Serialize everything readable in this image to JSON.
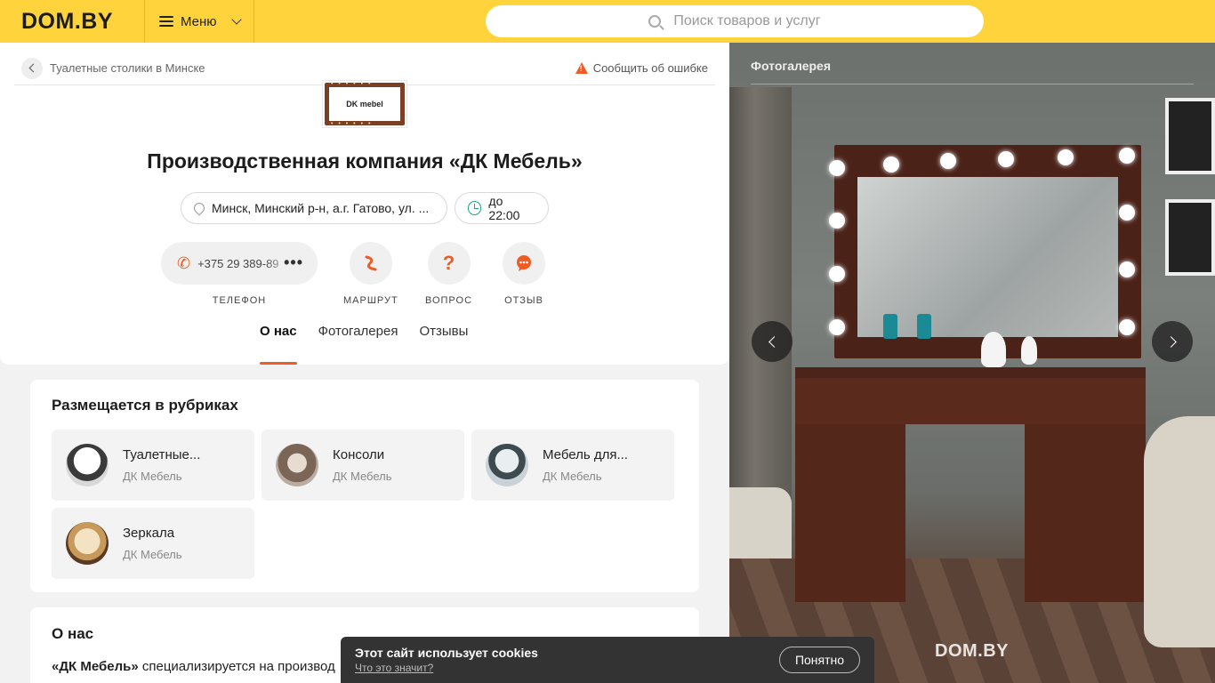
{
  "header": {
    "logo": "DOM.BY",
    "menu_label": "Меню",
    "search_placeholder": "Поиск товаров и услуг"
  },
  "breadcrumb": {
    "label": "Туалетные столики в Минске"
  },
  "report_label": "Сообщить об ошибке",
  "company": {
    "logo_text": "DK mebel",
    "title": "Производственная компания «ДК Мебель»",
    "address": "Минск, Минский р-н, а.г. Гатово, ул. ...",
    "hours": "до 22:00"
  },
  "actions": {
    "phone_number": "+375 29 389-89",
    "phone_more": "•••",
    "phone_label": "ТЕЛЕФОН",
    "route_label": "МАРШРУТ",
    "question_label": "ВОПРОС",
    "review_label": "ОТЗЫВ"
  },
  "tabs": [
    {
      "label": "О нас"
    },
    {
      "label": "Фотогалерея"
    },
    {
      "label": "Отзывы"
    }
  ],
  "rubrics": {
    "title": "Размещается в рубриках",
    "items": [
      {
        "name": "Туалетные...",
        "company": "ДК Мебель"
      },
      {
        "name": "Консоли",
        "company": "ДК Мебель"
      },
      {
        "name": "Мебель для...",
        "company": "ДК Мебель"
      },
      {
        "name": "Зеркала",
        "company": "ДК Мебель"
      }
    ]
  },
  "about": {
    "title": "О нас",
    "text_bold": "«ДК Мебель»",
    "text": " специализируется на производ"
  },
  "gallery": {
    "title": "Фотогалерея",
    "watermark": "DOM.BY"
  },
  "cookie": {
    "title": "Этот сайт использует cookies",
    "link": "Что это значит?",
    "button": "Понятно"
  },
  "colors": {
    "brand_yellow": "#fed33c",
    "accent_orange": "#ef5b24",
    "hours_green": "#1aa87a"
  }
}
